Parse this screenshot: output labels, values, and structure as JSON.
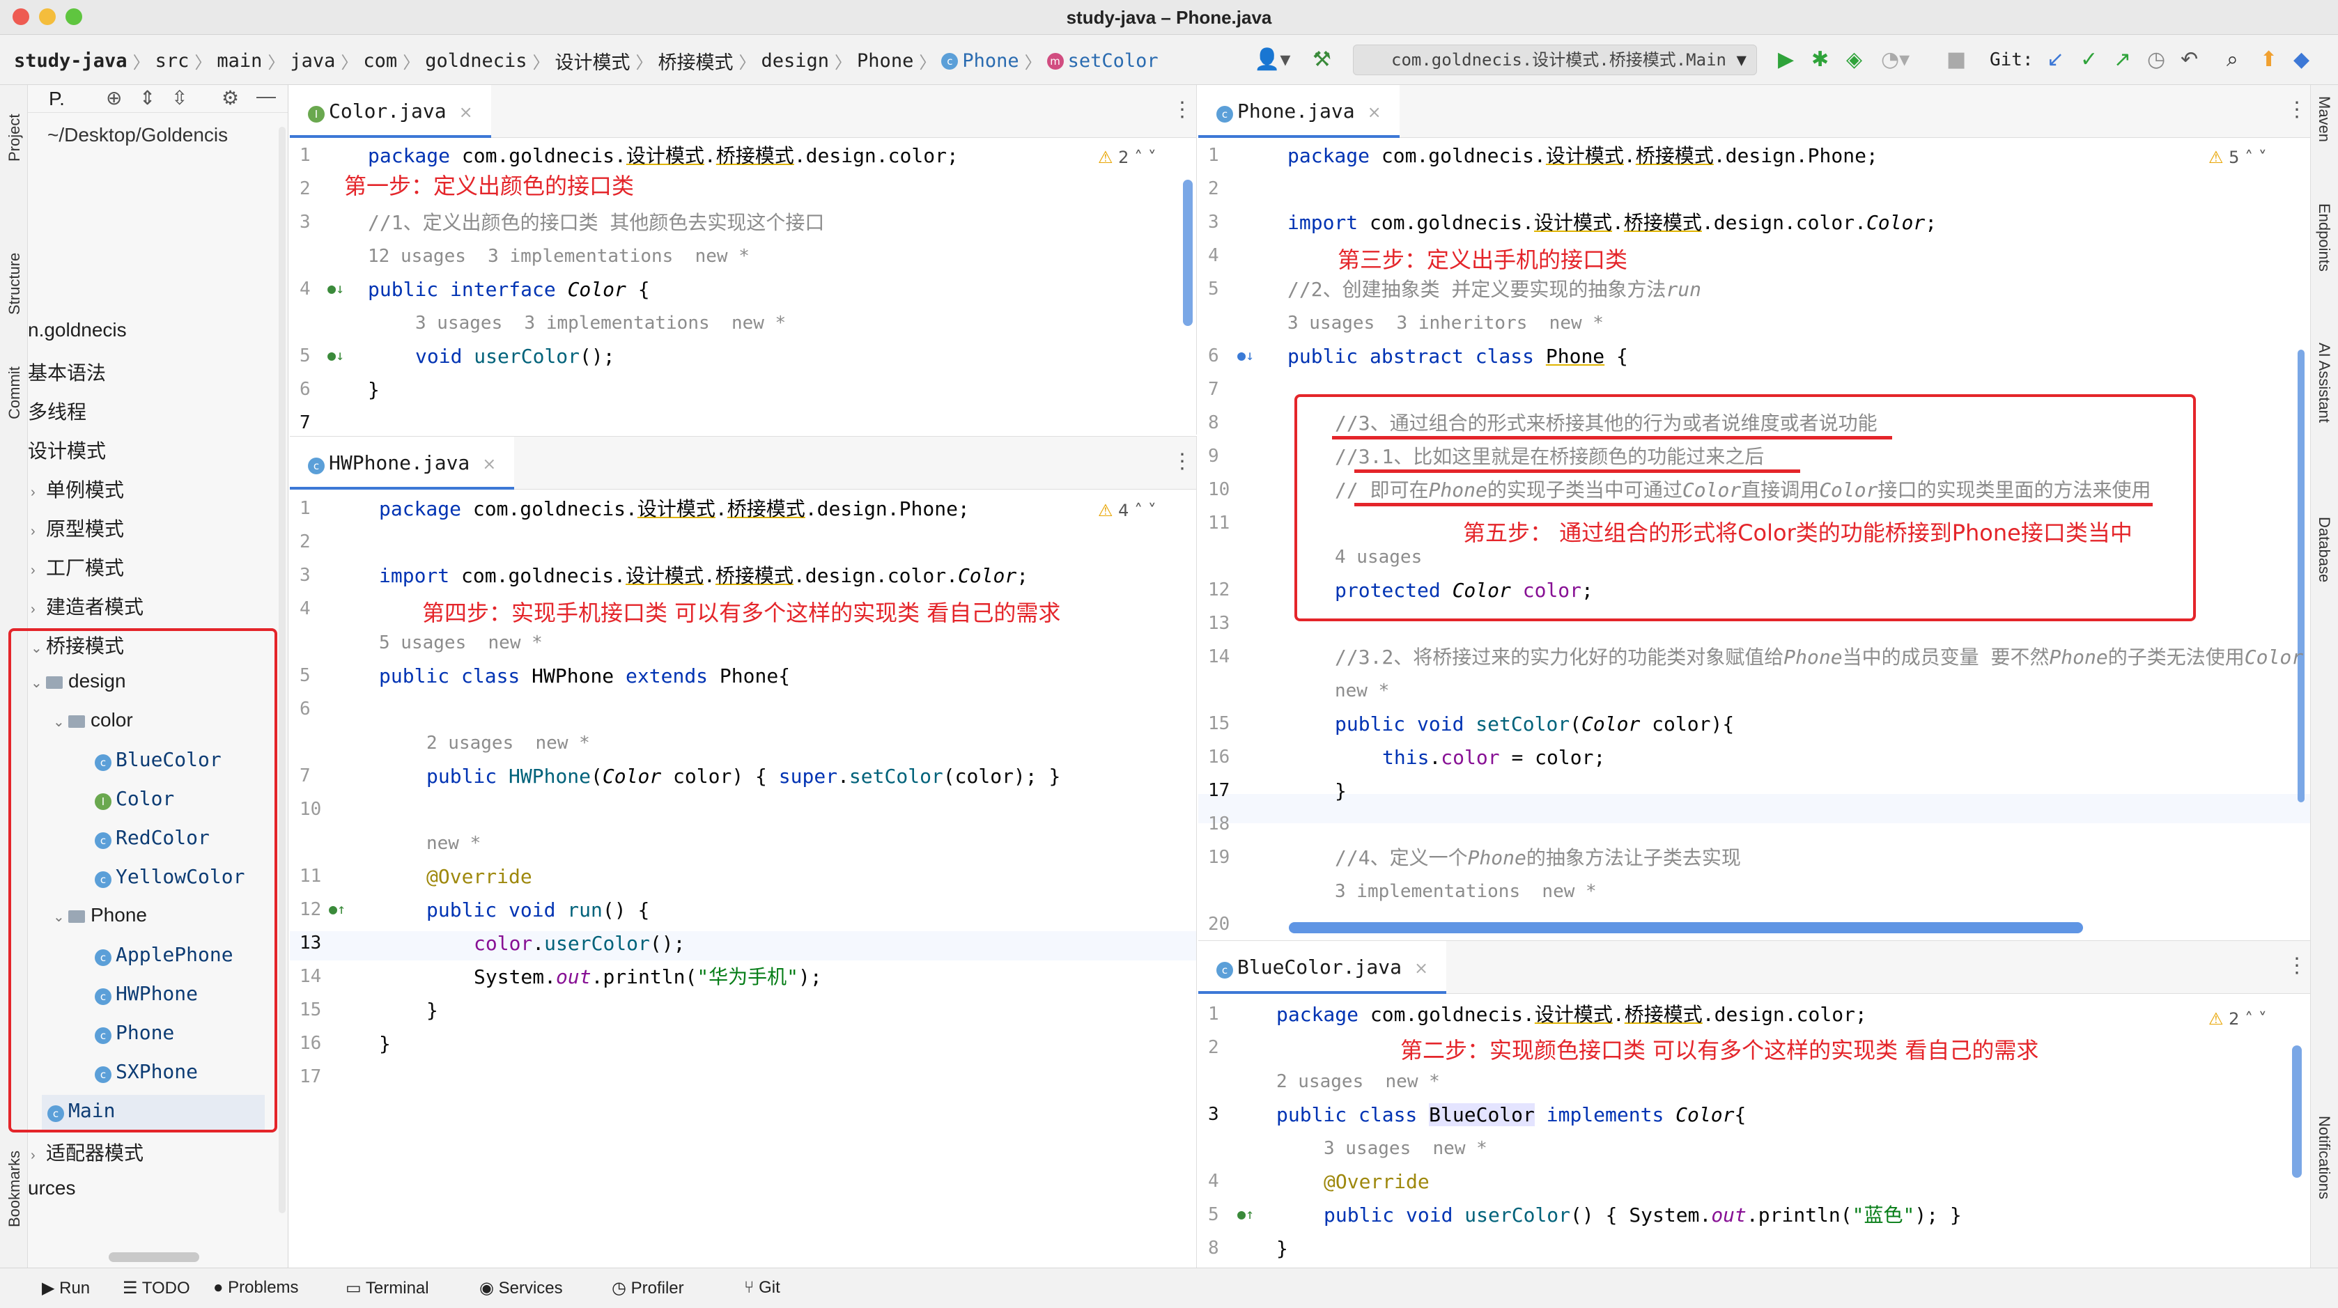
{
  "window": {
    "title": "study-java – Phone.java"
  },
  "breadcrumb": [
    "study-java",
    "src",
    "main",
    "java",
    "com",
    "goldnecis",
    "设计模式",
    "桥接模式",
    "design",
    "Phone",
    "Phone",
    "setColor"
  ],
  "toolbar": {
    "run_config": "com.goldnecis.设计模式.桥接模式.Main",
    "git_label": "Git:"
  },
  "left_strip": {
    "project": "Project",
    "structure": "Structure",
    "commit": "Commit",
    "bookmarks": "Bookmarks"
  },
  "right_strip": {
    "maven": "Maven",
    "endpoints": "Endpoints",
    "ai": "AI Assistant",
    "database": "Database",
    "notifications": "Notifications"
  },
  "project": {
    "header_label": "P.",
    "path": "~/Desktop/Goldencis",
    "tree": [
      "n.goldnecis",
      "基本语法",
      "多线程",
      "设计模式",
      "单例模式",
      "原型模式",
      "工厂模式",
      "建造者模式",
      "桥接模式",
      "design",
      "color",
      "BlueColor",
      "Color",
      "RedColor",
      "YellowColor",
      "Phone",
      "ApplePhone",
      "HWPhone",
      "Phone",
      "SXPhone",
      "Main",
      "适配器模式",
      "urces"
    ]
  },
  "editors": {
    "color": {
      "tab": "Color.java",
      "warn": "2",
      "lines": [
        "1",
        "2",
        "3",
        "4",
        "5",
        "6",
        "7"
      ],
      "code": {
        "l1_kw": "package",
        "l1_pkg_a": " com.goldnecis.",
        "l1_pkg_b": "设计模式",
        "l1_pkg_c": ".",
        "l1_pkg_d": "桥接模式",
        "l1_pkg_e": ".design.color;",
        "l3": "//1、定义出颜色的接口类 其他颜色去实现这个接口",
        "h1": "12 usages  3 implementations  new *",
        "l4_a": "public interface ",
        "l4_b": "Color",
        "l4_c": " {",
        "h2": "3 usages  3 implementations  new *",
        "l5_a": "void ",
        "l5_b": "userColor",
        "l5_c": "();",
        "l6": "}"
      },
      "annotation": "第一步：定义出颜色的接口类"
    },
    "hwphone": {
      "tab": "HWPhone.java",
      "warn": "4",
      "lines": [
        "1",
        "2",
        "3",
        "4",
        "5",
        "6",
        "7",
        "10",
        "11",
        "12",
        "13",
        "14",
        "15",
        "16",
        "17"
      ],
      "code": {
        "l1_kw": "package",
        "l1_a": " com.goldnecis.",
        "l1_b": "设计模式",
        "l1_c": ".",
        "l1_d": "桥接模式",
        "l1_e": ".design.Phone;",
        "l3_kw": "import",
        "l3_a": " com.goldnecis.",
        "l3_b": "设计模式",
        "l3_c": ".",
        "l3_d": "桥接模式",
        "l3_e": ".design.color.",
        "l3_f": "Color",
        "l3_g": ";",
        "h1": "5 usages  new *",
        "l5_a": "public class ",
        "l5_b": "HWPhone",
        "l5_c": " extends ",
        "l5_d": "Phone",
        "l5_e": "{",
        "h2": "2 usages  new *",
        "l7_a": "public ",
        "l7_b": "HWPhone",
        "l7_c": "(",
        "l7_d": "Color",
        "l7_e": " color) { ",
        "l7_f": "super",
        "l7_g": ".",
        "l7_h": "setColor",
        "l7_i": "(color); }",
        "h3": "new *",
        "l11": "@Override",
        "l12_a": "public void ",
        "l12_b": "run",
        "l12_c": "() {",
        "l13_a": "color",
        "l13_b": ".",
        "l13_c": "userColor",
        "l13_d": "();",
        "l14_a": "System.",
        "l14_b": "out",
        "l14_c": ".println(",
        "l14_d": "\"华为手机\"",
        "l14_e": ");",
        "l15": "}",
        "l16": "}"
      },
      "annotation": "第四步：实现手机接口类 可以有多个这样的实现类 看自己的需求"
    },
    "phone": {
      "tab": "Phone.java",
      "warn": "5",
      "lines": [
        "1",
        "2",
        "3",
        "4",
        "5",
        "6",
        "7",
        "8",
        "9",
        "10",
        "11",
        "12",
        "13",
        "14",
        "15",
        "16",
        "17",
        "18",
        "19",
        "20"
      ],
      "code": {
        "l1_kw": "package",
        "l1_a": " com.goldnecis.",
        "l1_b": "设计模式",
        "l1_c": ".",
        "l1_d": "桥接模式",
        "l1_e": ".design.Phone;",
        "l3_kw": "import",
        "l3_a": " com.goldnecis.",
        "l3_b": "设计模式",
        "l3_c": ".",
        "l3_d": "桥接模式",
        "l3_e": ".design.color.",
        "l3_f": "Color",
        "l3_g": ";",
        "l5": "//2、创建抽象类 并定义要实现的抽象方法",
        "l5_i": "run",
        "h1": "3 usages  3 inheritors  new *",
        "l6_a": "public abstract class ",
        "l6_b": "Phone",
        "l6_c": " {",
        "l8": "//3、通过组合的形式来桥接其他的行为或者说维度或者说功能",
        "l9": "//3.1、比如这里就是在桥接颜色的功能过来之后",
        "l10_a": "// 即可在",
        "l10_b": "Phone",
        "l10_c": "的实现子类当中可通过",
        "l10_d": "Color",
        "l10_e": "直接调用",
        "l10_f": "Color",
        "l10_g": "接口的实现类里面的方法来使用",
        "h2": "4 usages",
        "l12_a": "protected ",
        "l12_b": "Color",
        "l12_c": " ",
        "l12_d": "color",
        "l12_e": ";",
        "l14_a": "//3.2、将桥接过来的实力化好的功能类对象赋值给",
        "l14_b": "Phone",
        "l14_c": "当中的成员变量 要不然",
        "l14_d": "Phone",
        "l14_e": "的子类无法使用",
        "l14_f": "Color",
        "h3": "new *",
        "l15_a": "public void ",
        "l15_b": "setColor",
        "l15_c": "(",
        "l15_d": "Color",
        "l15_e": " color){",
        "l16_a": "this",
        "l16_b": ".",
        "l16_c": "color",
        "l16_d": " = color;",
        "l17": "}",
        "l19_a": "//4、定义一个",
        "l19_b": "Phone",
        "l19_c": "的抽象方法让子类去实现",
        "h4": "3 implementations  new *"
      },
      "annotation_3": "第三步：定义出手机的接口类",
      "annotation_5": "第五步： 通过组合的形式将Color类的功能桥接到Phone接口类当中"
    },
    "bluecolor": {
      "tab": "BlueColor.java",
      "warn": "2",
      "lines": [
        "1",
        "2",
        "3",
        "4",
        "5",
        "8"
      ],
      "code": {
        "l1_kw": "package",
        "l1_a": " com.goldnecis.",
        "l1_b": "设计模式",
        "l1_c": ".",
        "l1_d": "桥接模式",
        "l1_e": ".design.color;",
        "h1": "2 usages  new *",
        "l3_a": "public class ",
        "l3_b": "BlueColor",
        "l3_c": " implements ",
        "l3_d": "Color",
        "l3_e": "{",
        "h2": "3 usages  new *",
        "l4": "@Override",
        "l5_a": "public void ",
        "l5_b": "userColor",
        "l5_c": "() { ",
        "l5_d": "System.",
        "l5_e": "out",
        "l5_f": ".println(",
        "l5_g": "\"蓝色\"",
        "l5_h": "); }",
        "l8": "}"
      },
      "annotation": "第二步：实现颜色接口类 可以有多个这样的实现类 看自己的需求"
    }
  },
  "bottom_bar": [
    "Run",
    "TODO",
    "Problems",
    "Terminal",
    "Services",
    "Profiler",
    "Git"
  ],
  "colors": {
    "annotation_red": "#e4252a",
    "accent_blue": "#3d78d6"
  }
}
